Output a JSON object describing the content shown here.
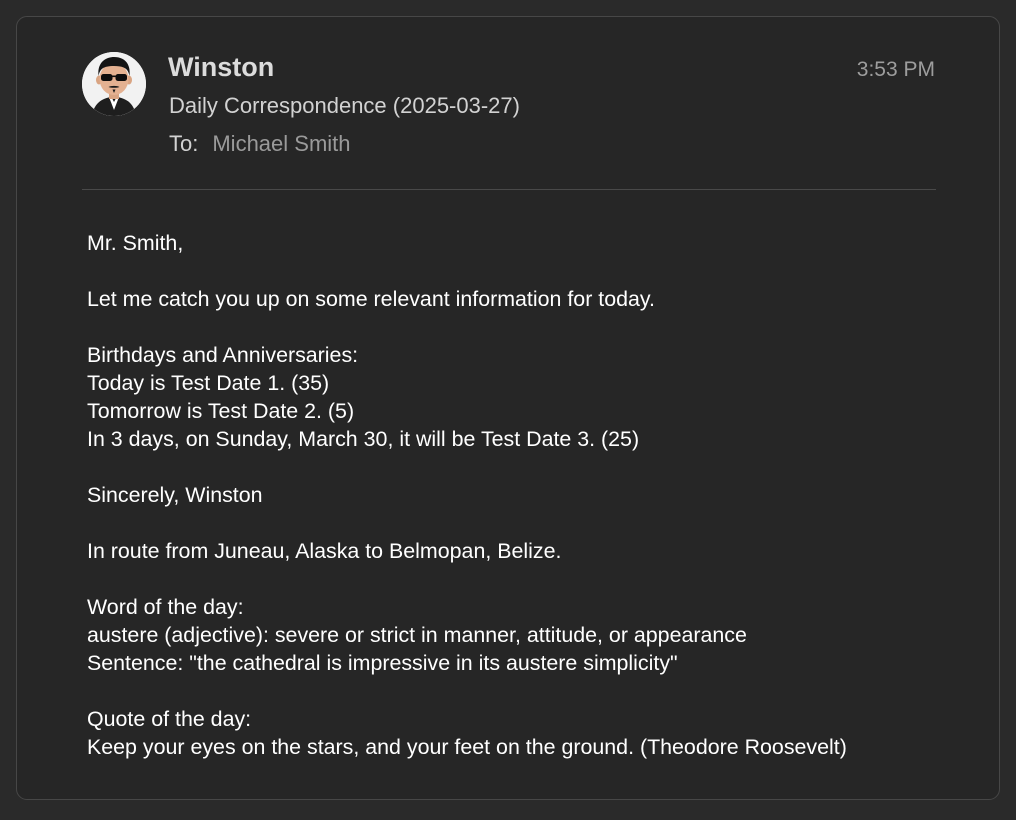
{
  "message": {
    "sender": "Winston",
    "subject": "Daily Correspondence (2025-03-27)",
    "to_label": "To:",
    "to_value": "Michael Smith",
    "time": "3:53 PM",
    "avatar_icon": "avatar-man-sunglasses",
    "body": {
      "greeting": "Mr. Smith,",
      "intro": "Let me catch you up on some relevant information for today.",
      "birthdays_heading": "Birthdays and Anniversaries:",
      "birthday_1": "Today is Test Date 1. (35)",
      "birthday_2": "Tomorrow is Test Date 2. (5)",
      "birthday_3": "In 3 days, on Sunday, March 30, it will be Test Date 3. (25)",
      "signoff": "Sincerely, Winston",
      "route": "In route from Juneau, Alaska to Belmopan, Belize.",
      "word_heading": "Word of the day:",
      "word_definition": "austere (adjective): severe or strict in manner, attitude, or appearance",
      "word_sentence": "Sentence: \"the cathedral is impressive in its austere simplicity\"",
      "quote_heading": "Quote of the day:",
      "quote_text": "Keep your eyes on the stars, and your feet on the ground. (Theodore Roosevelt)"
    }
  },
  "colors": {
    "background": "#2a2a2a",
    "panel": "#262626",
    "border": "#474747",
    "text_primary": "#ffffff",
    "text_secondary": "#9a9a9a"
  }
}
